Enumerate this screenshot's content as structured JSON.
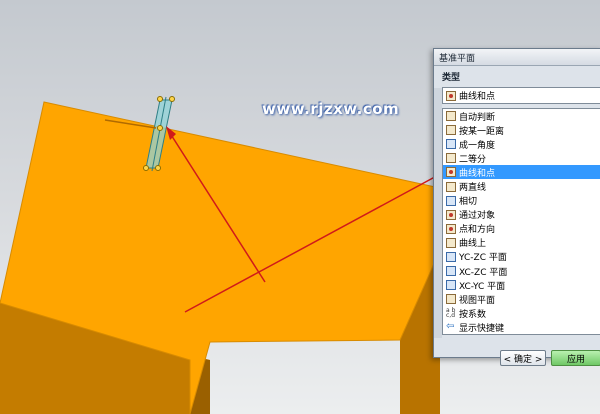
{
  "watermark": "www.rjzxw.com",
  "dialog": {
    "title": "基准平面",
    "section_label": "类型",
    "selected_value": "曲线和点",
    "items": [
      {
        "label": "自动判断",
        "icon": "auto-infer-icon"
      },
      {
        "label": "按某一距离",
        "icon": "distance-icon"
      },
      {
        "label": "成一角度",
        "icon": "angle-icon"
      },
      {
        "label": "二等分",
        "icon": "bisector-icon"
      },
      {
        "label": "曲线和点",
        "icon": "curve-point-icon"
      },
      {
        "label": "两直线",
        "icon": "two-lines-icon"
      },
      {
        "label": "相切",
        "icon": "tangent-icon"
      },
      {
        "label": "通过对象",
        "icon": "through-object-icon"
      },
      {
        "label": "点和方向",
        "icon": "point-direction-icon"
      },
      {
        "label": "曲线上",
        "icon": "on-curve-icon"
      },
      {
        "label": "YC-ZC 平面",
        "icon": "yc-zc-plane-icon"
      },
      {
        "label": "XC-ZC 平面",
        "icon": "xc-zc-plane-icon"
      },
      {
        "label": "XC-YC 平面",
        "icon": "xc-yc-plane-icon"
      },
      {
        "label": "视图平面",
        "icon": "view-plane-icon"
      },
      {
        "label": "按系数",
        "icon": "coefficients-icon"
      },
      {
        "label": "显示快捷键",
        "icon": "shortcut-arrow-icon"
      }
    ],
    "ok_label": "< 确定 >",
    "apply_label": "应用"
  },
  "colors": {
    "part_face": "#ffa500",
    "part_side": "#c07a00",
    "annotation_arrow": "#d01a1a",
    "selection_highlight": "#3399ff",
    "apply_button": "#6fc865"
  }
}
